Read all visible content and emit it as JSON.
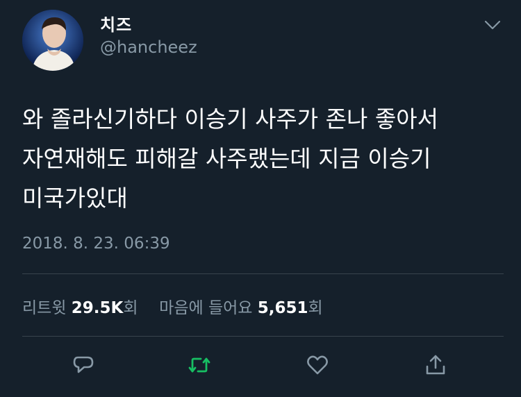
{
  "user": {
    "display_name": "치즈",
    "handle": "@hancheez"
  },
  "tweet": {
    "text": "와 졸라신기하다 이승기 사주가 존나 좋아서 자연재해도 피해갈 사주랬는데 지금 이승기 미국가있대",
    "timestamp": "2018. 8. 23. 06:39"
  },
  "stats": {
    "retweets_label": "리트윗",
    "retweets_value": "29.5K",
    "retweets_unit": "회",
    "likes_label": "마음에 들어요",
    "likes_value": "5,651",
    "likes_unit": "회"
  },
  "actions": {
    "reply_icon": "reply-icon",
    "retweet_icon": "retweet-icon",
    "like_icon": "heart-icon",
    "share_icon": "share-icon"
  },
  "colors": {
    "background": "#15202b",
    "text_primary": "#ffffff",
    "text_secondary": "#8899a6",
    "divider": "#38444d",
    "retweet_active": "#17bf63"
  }
}
